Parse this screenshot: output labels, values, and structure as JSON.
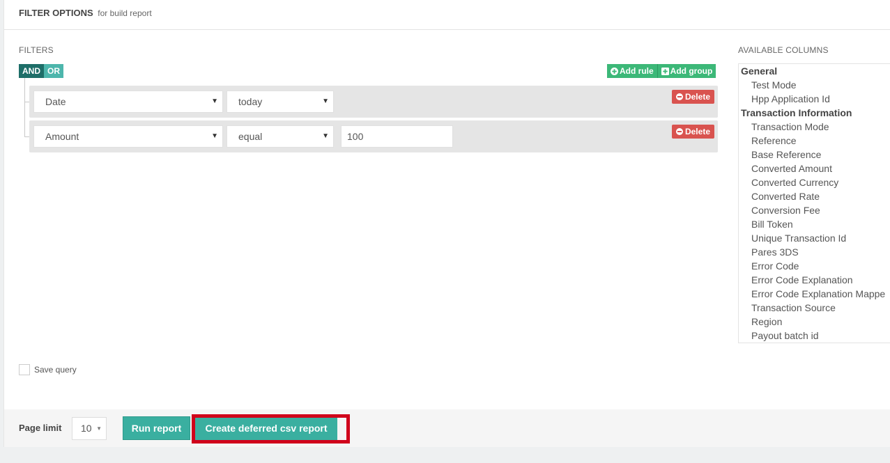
{
  "header": {
    "title": "FILTER OPTIONS",
    "subtitle": "for build report"
  },
  "filters": {
    "label": "FILTERS",
    "condition_and": "AND",
    "condition_or": "OR",
    "add_rule_label": "Add rule",
    "add_group_label": "Add group",
    "rules": [
      {
        "field": "Date",
        "operator": "today",
        "value": null,
        "delete_label": "Delete"
      },
      {
        "field": "Amount",
        "operator": "equal",
        "value": "100",
        "delete_label": "Delete"
      }
    ]
  },
  "columns": {
    "label": "AVAILABLE COLUMNS",
    "groups": [
      {
        "name": "General",
        "items": [
          "Test Mode",
          "Hpp Application Id"
        ]
      },
      {
        "name": "Transaction Information",
        "items": [
          "Transaction Mode",
          "Reference",
          "Base Reference",
          "Converted Amount",
          "Converted Currency",
          "Converted Rate",
          "Conversion Fee",
          "Bill Token",
          "Unique Transaction Id",
          "Pares 3DS",
          "Error Code",
          "Error Code Explanation",
          "Error Code Explanation Mappe",
          "Transaction Source",
          "Region",
          "Payout batch id"
        ]
      }
    ]
  },
  "save_query": {
    "label": "Save query",
    "checked": false
  },
  "footer": {
    "page_limit_label": "Page limit",
    "page_limit_value": "10",
    "run_report_label": "Run report",
    "create_csv_label": "Create deferred csv report"
  },
  "colors": {
    "primary_teal": "#3aafa0",
    "and_active": "#1e6e68",
    "add_green": "#3cb878",
    "delete_red": "#d9534f",
    "highlight_red": "#d0021b"
  }
}
